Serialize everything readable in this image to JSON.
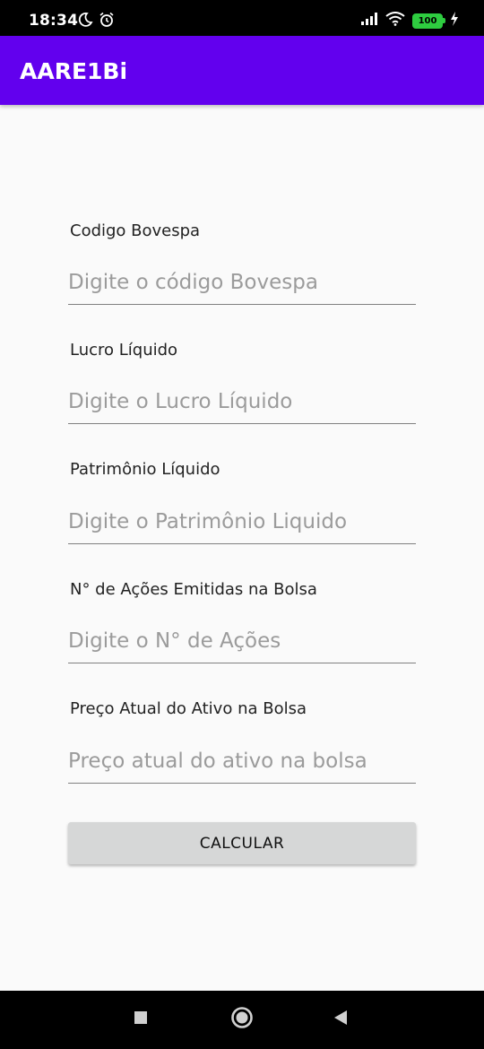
{
  "status_bar": {
    "time": "18:34",
    "icons": [
      "moon-icon",
      "alarm-icon",
      "signal-icon",
      "wifi-icon",
      "battery-icon",
      "charging-icon"
    ],
    "battery_level": "100"
  },
  "app_bar": {
    "title": "AARE1Bi",
    "color": "#6200ee"
  },
  "form": {
    "fields": [
      {
        "label": "Codigo Bovespa",
        "value": "",
        "placeholder": "Digite o código Bovespa"
      },
      {
        "label": "Lucro Líquido",
        "value": "",
        "placeholder": "Digite o Lucro Líquido"
      },
      {
        "label": "Patrimônio Líquido",
        "value": "",
        "placeholder": "Digite o Patrimônio Liquido"
      },
      {
        "label": "N° de Ações Emitidas na Bolsa",
        "value": "",
        "placeholder": "Digite o N° de Ações"
      },
      {
        "label": "Preço Atual do Ativo na Bolsa",
        "value": "",
        "placeholder": "Preço atual do ativo na bolsa"
      }
    ],
    "submit_label": "CALCULAR"
  },
  "nav_bar": {
    "icons": [
      "recents-icon",
      "home-icon",
      "back-icon"
    ]
  }
}
